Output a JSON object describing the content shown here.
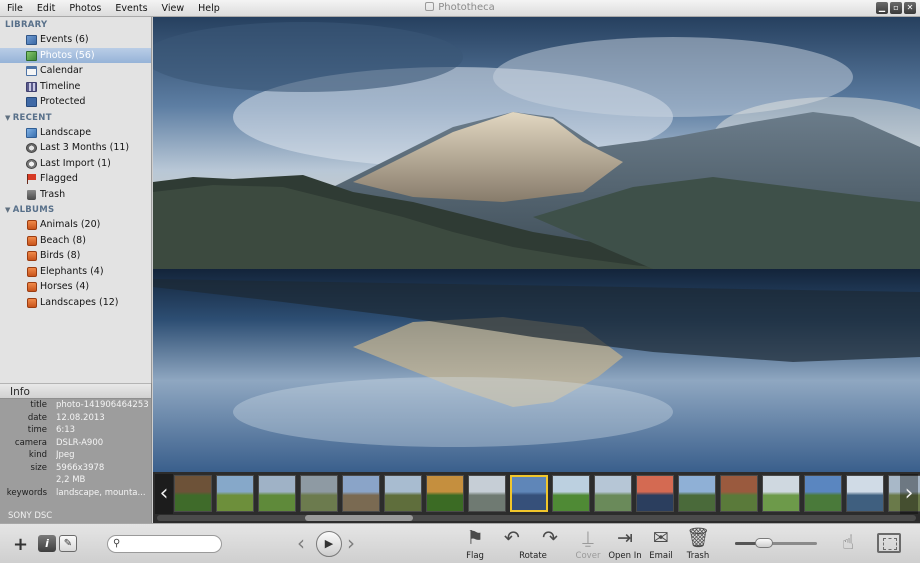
{
  "window": {
    "title": "Phototheca"
  },
  "menu": [
    "File",
    "Edit",
    "Photos",
    "Events",
    "View",
    "Help"
  ],
  "sidebar": {
    "library_header": "LIBRARY",
    "library": [
      {
        "label": "Events (6)",
        "icon": "events-icon"
      },
      {
        "label": "Photos (56)",
        "icon": "photos-icon",
        "selected": true
      },
      {
        "label": "Calendar",
        "icon": "calendar-icon"
      },
      {
        "label": "Timeline",
        "icon": "timeline-icon"
      },
      {
        "label": "Protected",
        "icon": "lock-icon"
      }
    ],
    "recent_header": "RECENT",
    "recent": [
      {
        "label": "Landscape",
        "icon": "landscape-icon"
      },
      {
        "label": "Last 3 Months (11)",
        "icon": "clock-icon"
      },
      {
        "label": "Last Import (1)",
        "icon": "import-icon"
      },
      {
        "label": "Flagged",
        "icon": "flag-icon"
      },
      {
        "label": "Trash",
        "icon": "trash-icon"
      }
    ],
    "albums_header": "ALBUMS",
    "albums": [
      {
        "label": "Animals (20)"
      },
      {
        "label": "Beach (8)"
      },
      {
        "label": "Birds (8)"
      },
      {
        "label": "Elephants (4)"
      },
      {
        "label": "Horses (4)"
      },
      {
        "label": "Landscapes (12)"
      }
    ]
  },
  "info": {
    "header": "Info",
    "rows": [
      {
        "key": "title",
        "value": "photo-141906464253"
      },
      {
        "key": "date",
        "value": "12.08.2013"
      },
      {
        "key": "time",
        "value": "6:13"
      },
      {
        "key": "camera",
        "value": "DSLR-A900"
      },
      {
        "key": "kind",
        "value": "Jpeg"
      },
      {
        "key": "size",
        "value": "5966x3978"
      },
      {
        "key": "",
        "value": "2,2 MB"
      },
      {
        "key": "keywords",
        "value": "landscape, mounta..."
      }
    ],
    "note": "SONY DSC"
  },
  "filmstrip": {
    "selected_index": 8,
    "thumb_count": 18
  },
  "toolbar": {
    "search_placeholder": "",
    "flag_label": "Flag",
    "rotate_label": "Rotate",
    "cover_label": "Cover",
    "openin_label": "Open In",
    "email_label": "Email",
    "trash_label": "Trash",
    "zoom_level": 0.35
  },
  "colors": {
    "selection": "#96b3d8",
    "thumb_selected_border": "#f1c62b",
    "section_header": "#58708a"
  }
}
